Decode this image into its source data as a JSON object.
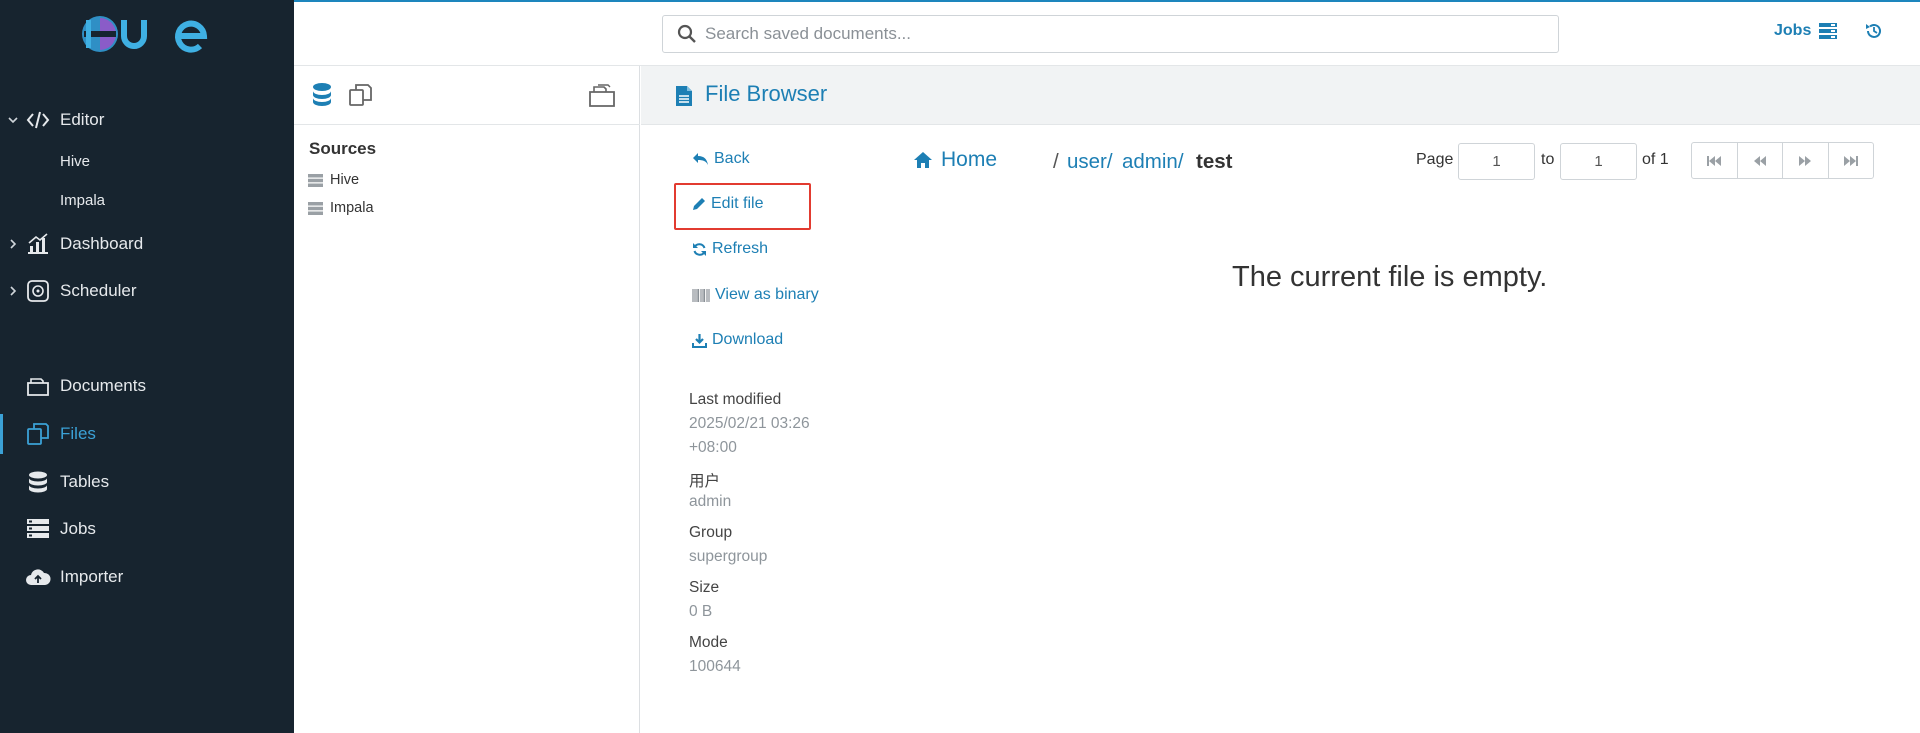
{
  "nav": {
    "logo_alt": "HUE",
    "editor": {
      "label": "Editor",
      "subitems": [
        "Hive",
        "Impala"
      ]
    },
    "dashboard": "Dashboard",
    "scheduler": "Scheduler",
    "documents": "Documents",
    "files": "Files",
    "tables": "Tables",
    "jobs": "Jobs",
    "importer": "Importer",
    "accent_color": "#3ba1d6",
    "background": "#17242f"
  },
  "topbar": {
    "search_placeholder": "Search saved documents...",
    "jobs_label": "Jobs"
  },
  "assist": {
    "sources_title": "Sources",
    "sources": [
      "Hive",
      "Impala"
    ]
  },
  "main": {
    "title": "File Browser",
    "actions": {
      "back": "Back",
      "edit": "Edit file",
      "refresh": "Refresh",
      "binary": "View as binary",
      "download": "Download"
    },
    "meta": {
      "last_modified_label": "Last modified",
      "last_modified_date": "2025/02/21 03:26",
      "last_modified_tz": "+08:00",
      "user_label": "用户",
      "user_value": "admin",
      "group_label": "Group",
      "group_value": "supergroup",
      "size_label": "Size",
      "size_value": "0 B",
      "mode_label": "Mode",
      "mode_value": "100644"
    },
    "breadcrumb": {
      "home": "Home",
      "sep": "/",
      "parts": [
        "user/",
        "admin/"
      ],
      "current": "test"
    },
    "pagination": {
      "page_label": "Page",
      "page_value": "1",
      "to_label": "to",
      "to_value": "1",
      "of_label": "of 1"
    },
    "empty_message": "The current file is empty.",
    "highlight_color": "#e23b30",
    "link_color": "#1d7fb4"
  }
}
